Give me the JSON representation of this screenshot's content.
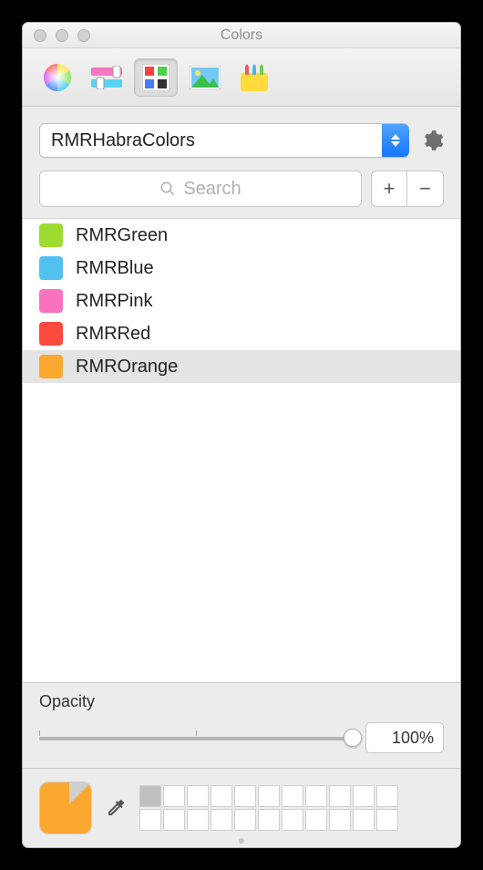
{
  "window": {
    "title": "Colors"
  },
  "toolbar": {
    "tabs": [
      "wheel",
      "sliders",
      "palettes",
      "image",
      "crayons"
    ],
    "active_index": 2
  },
  "palette_select": {
    "value": "RMRHabraColors"
  },
  "search": {
    "placeholder": "Search"
  },
  "buttons": {
    "add": "+",
    "remove": "−"
  },
  "colors": [
    {
      "name": "RMRGreen",
      "hex": "#9edb2f",
      "selected": false
    },
    {
      "name": "RMRBlue",
      "hex": "#52c1f0",
      "selected": false
    },
    {
      "name": "RMRPink",
      "hex": "#f972bf",
      "selected": false
    },
    {
      "name": "RMRRed",
      "hex": "#fc4a3e",
      "selected": false
    },
    {
      "name": "RMROrange",
      "hex": "#faa82f",
      "selected": true
    }
  ],
  "opacity": {
    "label": "Opacity",
    "value_text": "100%",
    "value": 100
  },
  "current_color": {
    "hex": "#faa82f"
  },
  "preset_wells": {
    "rows": 2,
    "cols": 11,
    "filled": [
      {
        "row": 0,
        "col": 0,
        "hex": "#bfbfbf"
      }
    ]
  }
}
